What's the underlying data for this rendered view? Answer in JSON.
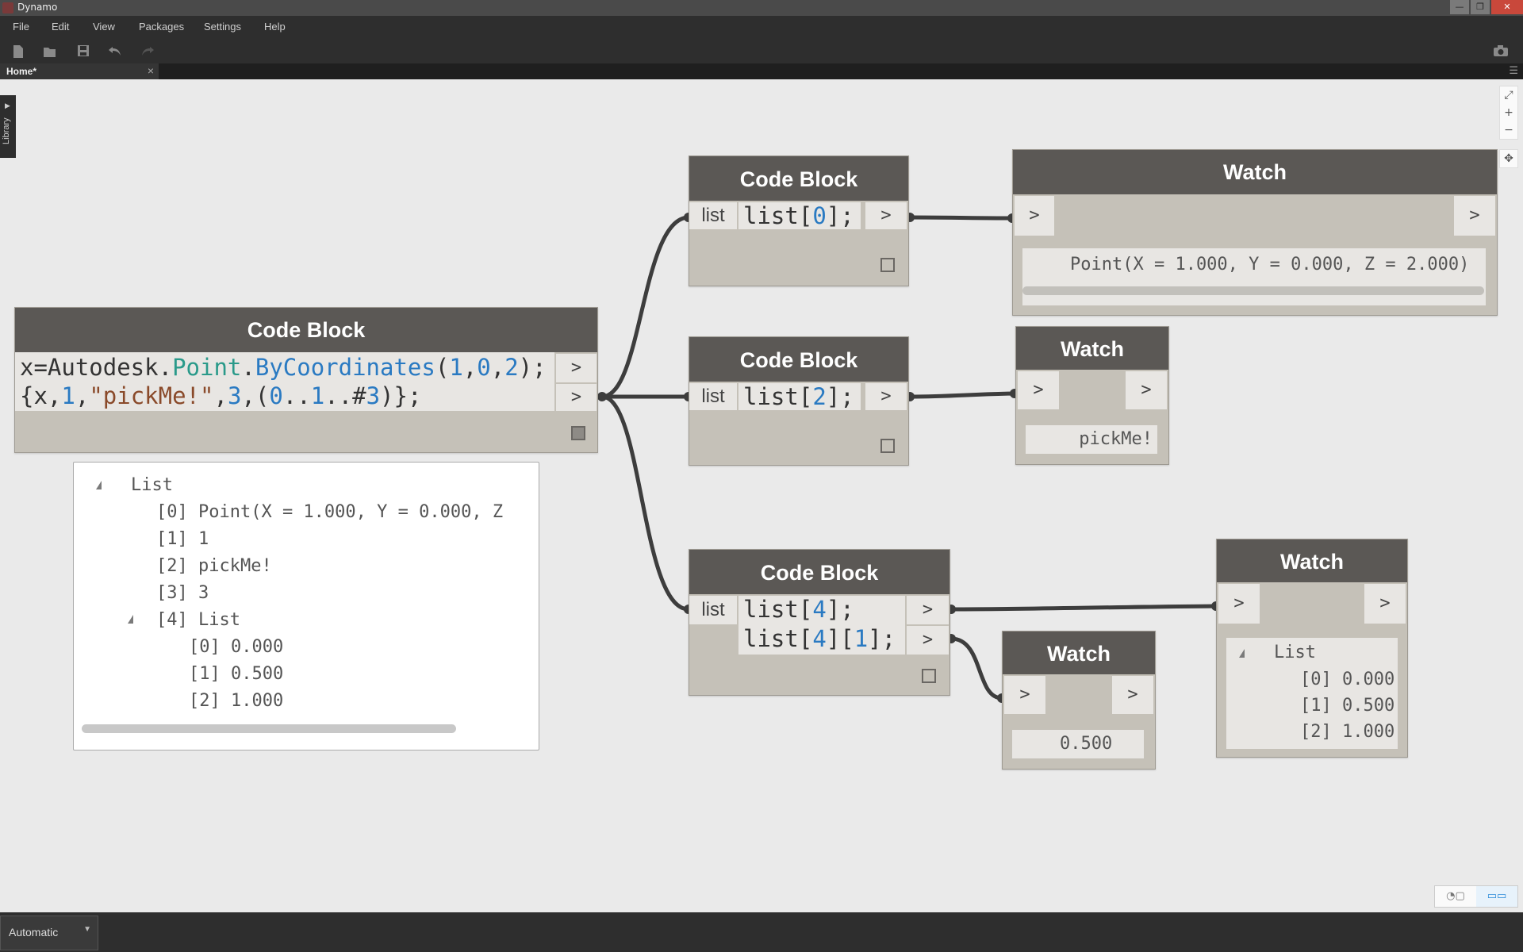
{
  "app": {
    "title": "Dynamo"
  },
  "window_buttons": {
    "minimize": "—",
    "maximize": "❐",
    "close": "✕"
  },
  "menu": [
    "File",
    "Edit",
    "View",
    "Packages",
    "Settings",
    "Help"
  ],
  "tab": {
    "label": "Home*",
    "close": "×"
  },
  "library": {
    "label": "Library"
  },
  "run_mode": {
    "label": "Automatic"
  },
  "nodes": {
    "main_code": {
      "title": "Code Block",
      "line1": [
        {
          "t": "x=Autodesk",
          "c": "plain"
        },
        {
          "t": ".",
          "c": "plain"
        },
        {
          "t": "Point",
          "c": "cls"
        },
        {
          "t": ".",
          "c": "plain"
        },
        {
          "t": "ByCoordinates",
          "c": "meth"
        },
        {
          "t": "(",
          "c": "plain"
        },
        {
          "t": "1",
          "c": "num"
        },
        {
          "t": ",",
          "c": "plain"
        },
        {
          "t": "0",
          "c": "num"
        },
        {
          "t": ",",
          "c": "plain"
        },
        {
          "t": "2",
          "c": "num"
        },
        {
          "t": ");",
          "c": "plain"
        }
      ],
      "line2": [
        {
          "t": "{x,",
          "c": "plain"
        },
        {
          "t": "1",
          "c": "num"
        },
        {
          "t": ",",
          "c": "plain"
        },
        {
          "t": "\"pickMe!\"",
          "c": "str"
        },
        {
          "t": ",",
          "c": "plain"
        },
        {
          "t": "3",
          "c": "num"
        },
        {
          "t": ",(",
          "c": "plain"
        },
        {
          "t": "0",
          "c": "num"
        },
        {
          "t": "..",
          "c": "plain"
        },
        {
          "t": "1",
          "c": "num"
        },
        {
          "t": "..#",
          "c": "plain"
        },
        {
          "t": "3",
          "c": "num"
        },
        {
          "t": ")};",
          "c": "plain"
        }
      ],
      "outputs": [
        ">",
        ">"
      ]
    },
    "code0": {
      "title": "Code Block",
      "input": "list",
      "line1": [
        {
          "t": "list[",
          "c": "plain"
        },
        {
          "t": "0",
          "c": "num"
        },
        {
          "t": "];",
          "c": "plain"
        }
      ],
      "output": ">"
    },
    "code2": {
      "title": "Code Block",
      "input": "list",
      "line1": [
        {
          "t": "list[",
          "c": "plain"
        },
        {
          "t": "2",
          "c": "num"
        },
        {
          "t": "];",
          "c": "plain"
        }
      ],
      "output": ">"
    },
    "code4": {
      "title": "Code Block",
      "input": "list",
      "line1": [
        {
          "t": "list[",
          "c": "plain"
        },
        {
          "t": "4",
          "c": "num"
        },
        {
          "t": "];",
          "c": "plain"
        }
      ],
      "line2": [
        {
          "t": "list[",
          "c": "plain"
        },
        {
          "t": "4",
          "c": "num"
        },
        {
          "t": "][",
          "c": "plain"
        },
        {
          "t": "1",
          "c": "num"
        },
        {
          "t": "];",
          "c": "plain"
        }
      ],
      "outputs": [
        ">",
        ">"
      ]
    },
    "watch1": {
      "title": "Watch",
      "in": ">",
      "out": ">",
      "value": "Point(X = 1.000, Y = 0.000, Z = 2.000)"
    },
    "watch2": {
      "title": "Watch",
      "in": ">",
      "out": ">",
      "value": "pickMe!"
    },
    "watch3": {
      "title": "Watch",
      "in": ">",
      "out": ">",
      "value": "0.500"
    },
    "watch4": {
      "title": "Watch",
      "in": ">",
      "out": ">",
      "list_label": "List",
      "items": [
        "[0] 0.000",
        "[1] 0.500",
        "[2] 1.000"
      ]
    }
  },
  "preview": {
    "root": "List",
    "items": [
      "[0] Point(X = 1.000, Y = 0.000, Z ",
      "[1] 1",
      "[2] pickMe!",
      "[3] 3"
    ],
    "sub_label": "[4] List",
    "sub_items": [
      "[0] 0.000",
      "[1] 0.500",
      "[2] 1.000"
    ]
  },
  "colors": {
    "wire": "#3d3d3d",
    "node_header": "#5b5855",
    "node_body": "#c5c1b8",
    "canvas": "#eaeaea",
    "accent": "#2a8ad8"
  }
}
